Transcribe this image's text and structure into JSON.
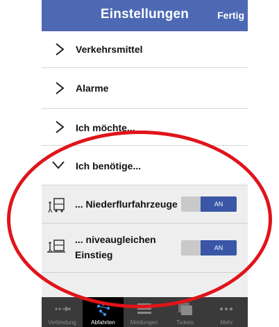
{
  "header": {
    "title": "Einstellungen",
    "done_label": "Fertig"
  },
  "menu": [
    {
      "label": "Verkehrsmittel",
      "expanded": false
    },
    {
      "label": "Alarme",
      "expanded": false
    },
    {
      "label": "Ich möchte...",
      "expanded": false
    },
    {
      "label": "Ich benötige...",
      "expanded": true
    }
  ],
  "options": [
    {
      "label_line1": "... Niederflurfahrzeuge",
      "label_line2": "",
      "state": "AN"
    },
    {
      "label_line1": "... niveaugleichen",
      "label_line2": "Einstieg",
      "state": "AN"
    }
  ],
  "tabbar": [
    {
      "label": "Verbindung",
      "icon": "route-dots-icon",
      "active": false
    },
    {
      "label": "Abfahrten",
      "icon": "departures-icon",
      "active": true
    },
    {
      "label": "Meldungen",
      "icon": "list-icon",
      "active": false
    },
    {
      "label": "Tickets",
      "icon": "tickets-icon",
      "active": false
    },
    {
      "label": "Mehr",
      "icon": "more-dots-icon",
      "active": false
    }
  ],
  "colors": {
    "header": "#4d69b3",
    "toggle_on": "#3a56a7",
    "highlight_ring": "#e0141b"
  }
}
